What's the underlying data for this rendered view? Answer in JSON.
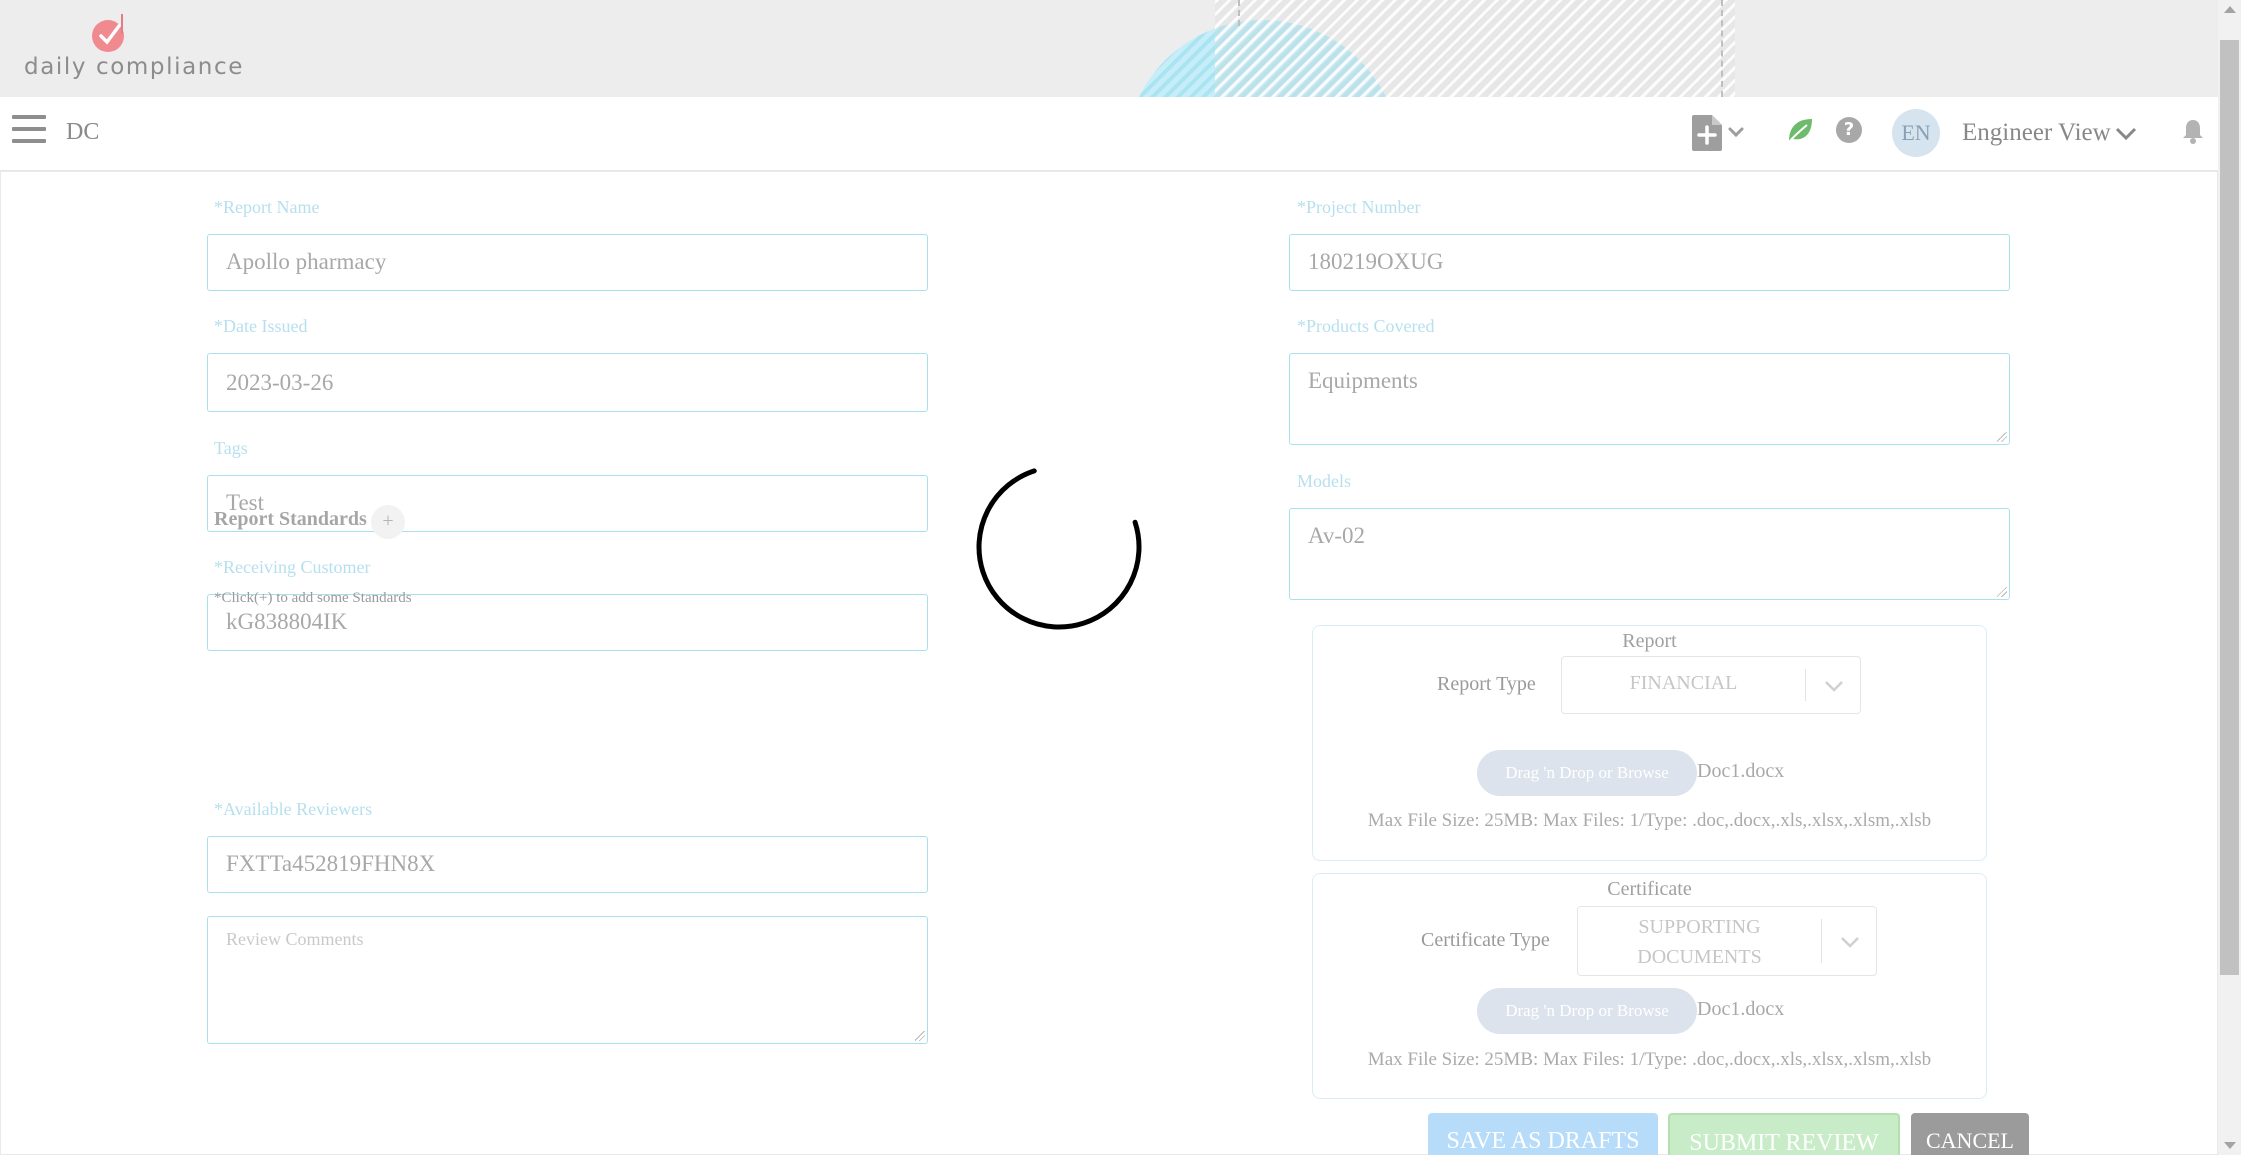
{
  "banner": {
    "logo_text": "daily compliance"
  },
  "nav": {
    "brand": "DC",
    "help_glyph": "?",
    "avatar_initials": "EN",
    "view_label": "Engineer View",
    "icons": [
      "menu-icon",
      "new-document-icon",
      "chevron-down-icon",
      "eco-leaf-icon",
      "help-icon",
      "bell-icon"
    ]
  },
  "form": {
    "report_name": {
      "label": "*Report Name",
      "value": "Apollo pharmacy"
    },
    "date_issued": {
      "label": "*Date Issued",
      "value": "2023-03-26"
    },
    "tags": {
      "label": "Tags",
      "value": "Test"
    },
    "receiving_customer": {
      "label": "*Receiving Customer",
      "value": "kG838804IK"
    },
    "report_standards": {
      "title": "Report Standards",
      "add_glyph": "+",
      "hint": "*Click(+) to add some Standards"
    },
    "available_reviewers": {
      "label": "*Available Reviewers",
      "value": "FXTTa452819FHN8X"
    },
    "review_comments": {
      "placeholder": "Review Comments"
    },
    "project_number": {
      "label": "*Project Number",
      "value": "180219OXUG"
    },
    "products_covered": {
      "label": "*Products Covered",
      "value": "Equipments"
    },
    "models": {
      "label": "Models",
      "value": "Av-02"
    }
  },
  "report_panel": {
    "title": "Report",
    "type_label": "Report Type",
    "type_value": "FINANCIAL",
    "dropzone_label": "Drag 'n Drop or Browse",
    "file_name": "Doc1.docx",
    "limits": "Max File Size: 25MB: Max Files: 1/Type: .doc,.docx,.xls,.xlsx,.xlsm,.xlsb"
  },
  "certificate_panel": {
    "title": "Certificate",
    "type_label": "Certificate Type",
    "type_value_line1": "SUPPORTING",
    "type_value_line2": "DOCUMENTS",
    "dropzone_label": "Drag 'n Drop or Browse",
    "file_name": "Doc1.docx",
    "limits": "Max File Size: 25MB: Max Files: 1/Type: .doc,.docx,.xls,.xlsx,.xlsm,.xlsb"
  },
  "actions": {
    "save_drafts": "SAVE AS DRAFTS",
    "submit_review": "SUBMIT REVIEW",
    "cancel": "CANCEL"
  },
  "colors": {
    "accent_label": "#b6e0ee",
    "field_border": "#a9e0ee",
    "draft_button": "#b6dcfa",
    "submit_button": "#c8ecc8",
    "cancel_button": "#9b9b9b",
    "logo_red": "#f08a8f",
    "leaf_green": "#6dbb6b"
  }
}
